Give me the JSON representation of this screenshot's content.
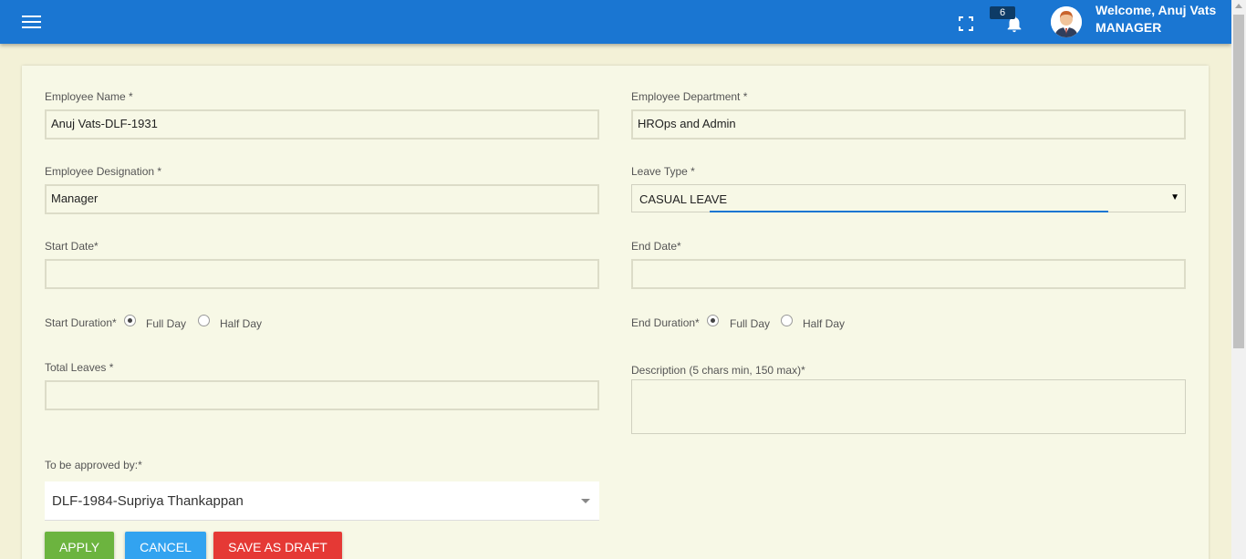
{
  "header": {
    "notification_count": "6",
    "welcome_text": "Welcome, Anuj Vats",
    "role": "MANAGER"
  },
  "form": {
    "employee_name": {
      "label": "Employee Name *",
      "value": "Anuj Vats-DLF-1931"
    },
    "employee_department": {
      "label": "Employee Department *",
      "value": "HROps and Admin"
    },
    "employee_designation": {
      "label": "Employee Designation *",
      "value": "Manager"
    },
    "leave_type": {
      "label": "Leave Type *",
      "value": "CASUAL LEAVE"
    },
    "start_date": {
      "label": "Start Date*",
      "value": ""
    },
    "end_date": {
      "label": "End Date*",
      "value": ""
    },
    "start_duration": {
      "label": "Start Duration*",
      "options": [
        "Full Day",
        "Half Day"
      ],
      "selected": "Full Day"
    },
    "end_duration": {
      "label": "End Duration*",
      "options": [
        "Full Day",
        "Half Day"
      ],
      "selected": "Full Day"
    },
    "total_leaves": {
      "label": "Total Leaves *",
      "value": ""
    },
    "description": {
      "label": "Description (5 chars min, 150 max)*",
      "value": ""
    },
    "approver": {
      "label": "To be approved by:*",
      "value": "DLF-1984-Supriya Thankappan"
    }
  },
  "buttons": {
    "apply": "APPLY",
    "cancel": "CANCEL",
    "save_draft": "SAVE AS DRAFT"
  },
  "colors": {
    "header": "#1a76d2",
    "apply": "#6cb43f",
    "cancel": "#32a3f0",
    "save_draft": "#e53935"
  },
  "icons": [
    "menu-icon",
    "fullscreen-icon",
    "bell-icon",
    "user-avatar"
  ]
}
